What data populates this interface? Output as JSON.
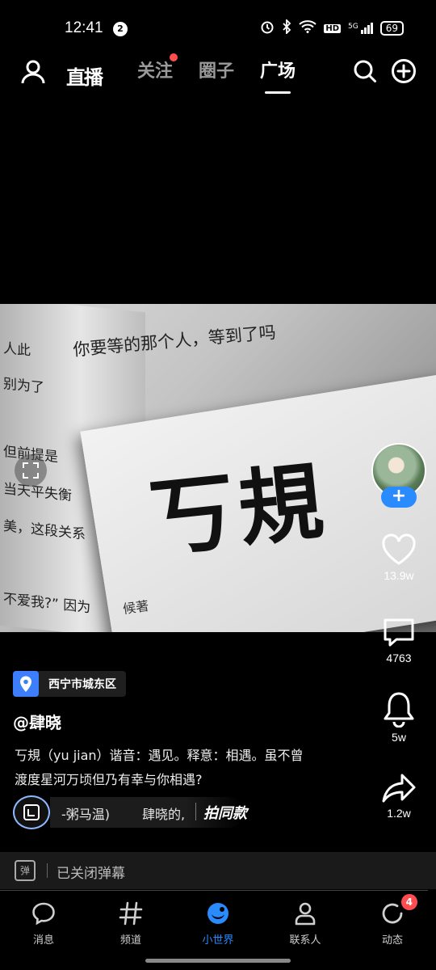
{
  "status": {
    "time": "12:41",
    "notification_count": "2",
    "network": "5G",
    "hd": "HD",
    "battery": "69"
  },
  "topnav": {
    "live_label": "直播",
    "tabs": [
      {
        "label": "关注",
        "has_dot": true
      },
      {
        "label": "圈子",
        "has_dot": false
      },
      {
        "label": "广场",
        "active": true
      }
    ]
  },
  "video": {
    "headline": "你要等的那个人，等到了吗",
    "calligraphy": "丂規",
    "card_author": "候著",
    "left_page_lines": [
      "人此",
      "别为了",
      "但前提是",
      "当天平失衡",
      "美，这段关系",
      "不爱我?” 因为"
    ]
  },
  "actions": {
    "likes": "13.9w",
    "comments": "4763",
    "favorites": "5w",
    "shares": "1.2w",
    "follow_label": "+"
  },
  "caption": {
    "location": "西宁市城东区",
    "author": "@肆晓",
    "description": "丂規（yu jian）谐音：遇见。释意：相遇。虽不曾渡度星河万顷但乃有幸与你相遇?",
    "music_title": "-粥马温)",
    "music_author": "肆晓的,",
    "same_style": "拍同款"
  },
  "danmaku": {
    "icon_label": "弹",
    "text": "已关闭弹幕"
  },
  "bottomnav": {
    "items": [
      {
        "label": "消息"
      },
      {
        "label": "频道"
      },
      {
        "label": "小世界"
      },
      {
        "label": "联系人"
      },
      {
        "label": "动态",
        "badge": "4"
      }
    ],
    "active_color": "#2a8bff"
  }
}
